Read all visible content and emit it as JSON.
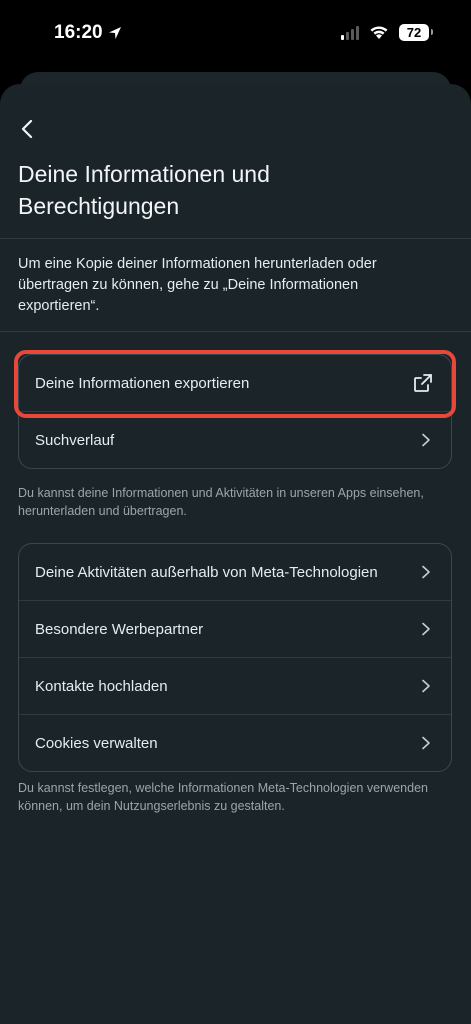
{
  "status_bar": {
    "time": "16:20",
    "battery": "72"
  },
  "header": {
    "title_line1": "Deine Informationen und",
    "title_line2": "Berechtigungen"
  },
  "intro_text": "Um eine Kopie deiner Informationen herunterladen oder übertragen zu können, gehe zu „Deine Informationen exportieren“.",
  "group1": {
    "items": [
      {
        "label": "Deine Informationen exportieren",
        "icon": "external-link-icon"
      },
      {
        "label": "Suchverlauf",
        "icon": "chevron-right-icon"
      }
    ],
    "caption": "Du kannst deine Informationen und Aktivitäten in unseren Apps einsehen, herunterladen und übertragen."
  },
  "group2": {
    "items": [
      {
        "label": "Deine Aktivitäten außerhalb von Meta-Technologien",
        "icon": "chevron-right-icon"
      },
      {
        "label": "Besondere Werbepartner",
        "icon": "chevron-right-icon"
      },
      {
        "label": "Kontakte hochladen",
        "icon": "chevron-right-icon"
      },
      {
        "label": "Cookies verwalten",
        "icon": "chevron-right-icon"
      }
    ],
    "caption": "Du kannst festlegen, welche Informationen Meta-Technologien verwenden können, um dein Nutzungserlebnis zu gestalten."
  },
  "colors": {
    "background": "#1b2429",
    "highlight": "#e8483a",
    "text": "#e6ecef",
    "caption": "#9aa6ac"
  }
}
